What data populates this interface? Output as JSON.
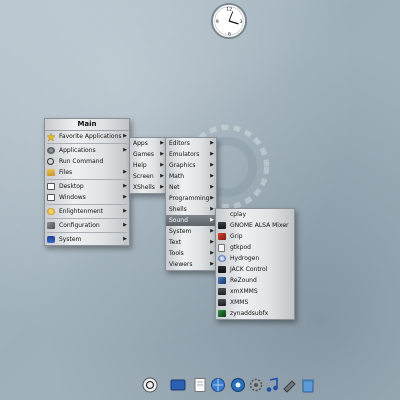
{
  "main_menu": {
    "title": "Main",
    "items": [
      {
        "label": "Favorite Applications",
        "icon": "star-icon",
        "submenu": true
      },
      {
        "label": "Applications",
        "icon": "gear-icon",
        "submenu": true
      },
      {
        "label": "Run Command",
        "icon": "magnifier-icon",
        "submenu": false
      },
      {
        "label": "Files",
        "icon": "folder-icon",
        "submenu": true
      },
      {
        "label": "Desktop",
        "icon": "monitor-icon",
        "submenu": true
      },
      {
        "label": "Windows",
        "icon": "window-icon",
        "submenu": true
      },
      {
        "label": "Enlightenment",
        "icon": "e-logo-icon",
        "submenu": true
      },
      {
        "label": "Configuration",
        "icon": "wrench-icon",
        "submenu": true
      },
      {
        "label": "System",
        "icon": "penguin-icon",
        "submenu": true
      }
    ]
  },
  "apps_menu": {
    "items": [
      "Apps",
      "Games",
      "Help",
      "Screen",
      "XShells"
    ]
  },
  "categories_menu": {
    "items": [
      "Editors",
      "Emulators",
      "Graphics",
      "Math",
      "Net",
      "Programming",
      "Shells",
      "Sound",
      "System",
      "Text",
      "Tools",
      "Viewers"
    ],
    "selected": "Sound"
  },
  "sound_menu": {
    "items": [
      {
        "label": "cplay",
        "icon": "blank-icon"
      },
      {
        "label": "GNOME ALSA Mixer",
        "icon": "mixer-icon"
      },
      {
        "label": "Grip",
        "icon": "grip-icon"
      },
      {
        "label": "gtkpod",
        "icon": "ipod-icon"
      },
      {
        "label": "Hydrogen",
        "icon": "hydrogen-icon"
      },
      {
        "label": "JACK Control",
        "icon": "jack-icon"
      },
      {
        "label": "ReZound",
        "icon": "rezound-icon"
      },
      {
        "label": "xmXMMS",
        "icon": "xmms-icon"
      },
      {
        "label": "XMMS",
        "icon": "xmms-icon"
      },
      {
        "label": "zynaddsubfx",
        "icon": "synth-icon"
      }
    ]
  },
  "dock": {
    "icons": [
      "e-logo-icon",
      "terminal-icon",
      "document-icon",
      "globe-icon",
      "network-icon",
      "settings-icon",
      "music-icon",
      "tools-icon",
      "trash-icon"
    ]
  },
  "colors": {
    "selection": "#6a7177",
    "menu_bg": "#e4e7e9"
  }
}
